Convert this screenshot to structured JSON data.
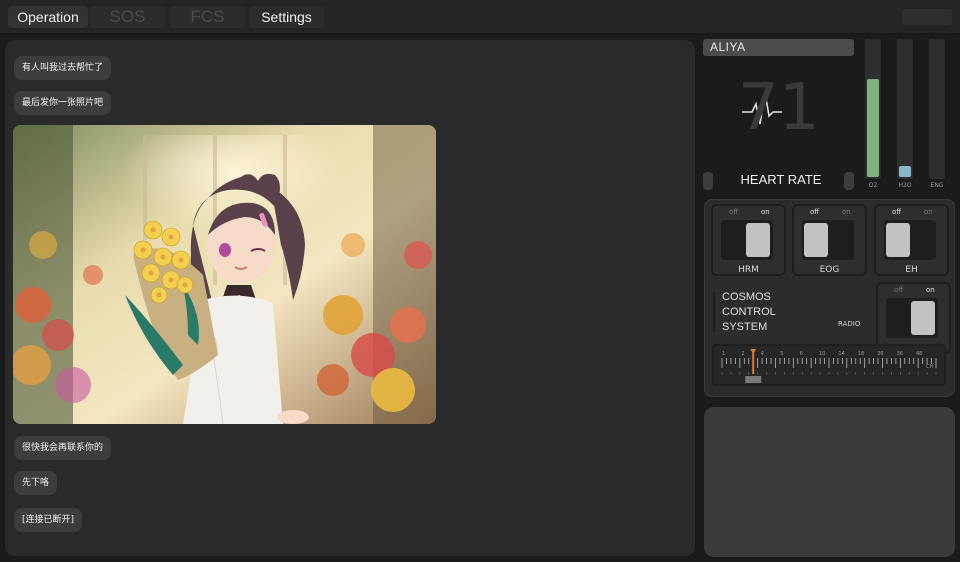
{
  "tabs": [
    {
      "label": "Operation",
      "state": "active"
    },
    {
      "label": "SOS",
      "state": "disabled"
    },
    {
      "label": "FCS",
      "state": "disabled"
    },
    {
      "label": "Settings",
      "state": "enabled"
    }
  ],
  "chat": {
    "messages": [
      {
        "text": "有人叫我过去帮忙了"
      },
      {
        "text": "最后发你一张照片吧"
      },
      {
        "text": "很快我会再联系你的"
      },
      {
        "text": "先下咯"
      },
      {
        "text": "[连接已断开]"
      }
    ],
    "photo_icon": "anime-girl-with-flower-bouquet-image"
  },
  "monitor": {
    "name": "ALIYA",
    "heart_rate_value": "71",
    "heart_rate_label": "HEART RATE",
    "heart_icon": "heartbeat-waveform-icon"
  },
  "gauges": [
    {
      "label": "O2",
      "level": 0.72,
      "color": "#7fb27f"
    },
    {
      "label": "H2O",
      "level": 0.08,
      "color": "#8ab8c8"
    },
    {
      "label": "ENG",
      "level": 0.0,
      "color": "#8a8a8a"
    }
  ],
  "switches": [
    {
      "name": "HRM",
      "off_label": "off",
      "on_label": "on",
      "state": "on"
    },
    {
      "name": "EOG",
      "off_label": "off",
      "on_label": "on",
      "state": "off"
    },
    {
      "name": "EH",
      "off_label": "off",
      "on_label": "on",
      "state": "off"
    }
  ],
  "system": {
    "line1": "COSMOS",
    "line2": "CONTROL",
    "line3": "SYSTEM",
    "radio_label": "RADIO",
    "radio_switch": {
      "off_label": "off",
      "on_label": "on",
      "state": "on"
    }
  },
  "tuner": {
    "scale_labels": [
      "1",
      "2",
      "4",
      "5",
      "6",
      "10",
      "14",
      "18",
      "26",
      "36",
      "48"
    ],
    "unit": "CH",
    "needle_value": 7,
    "needle_color": "#e07a1a"
  },
  "colors": {
    "background": "#1b1b1b",
    "panel": "#2a2a2a",
    "bubble": "#3d3d3d",
    "accent": "#e07a1a"
  }
}
